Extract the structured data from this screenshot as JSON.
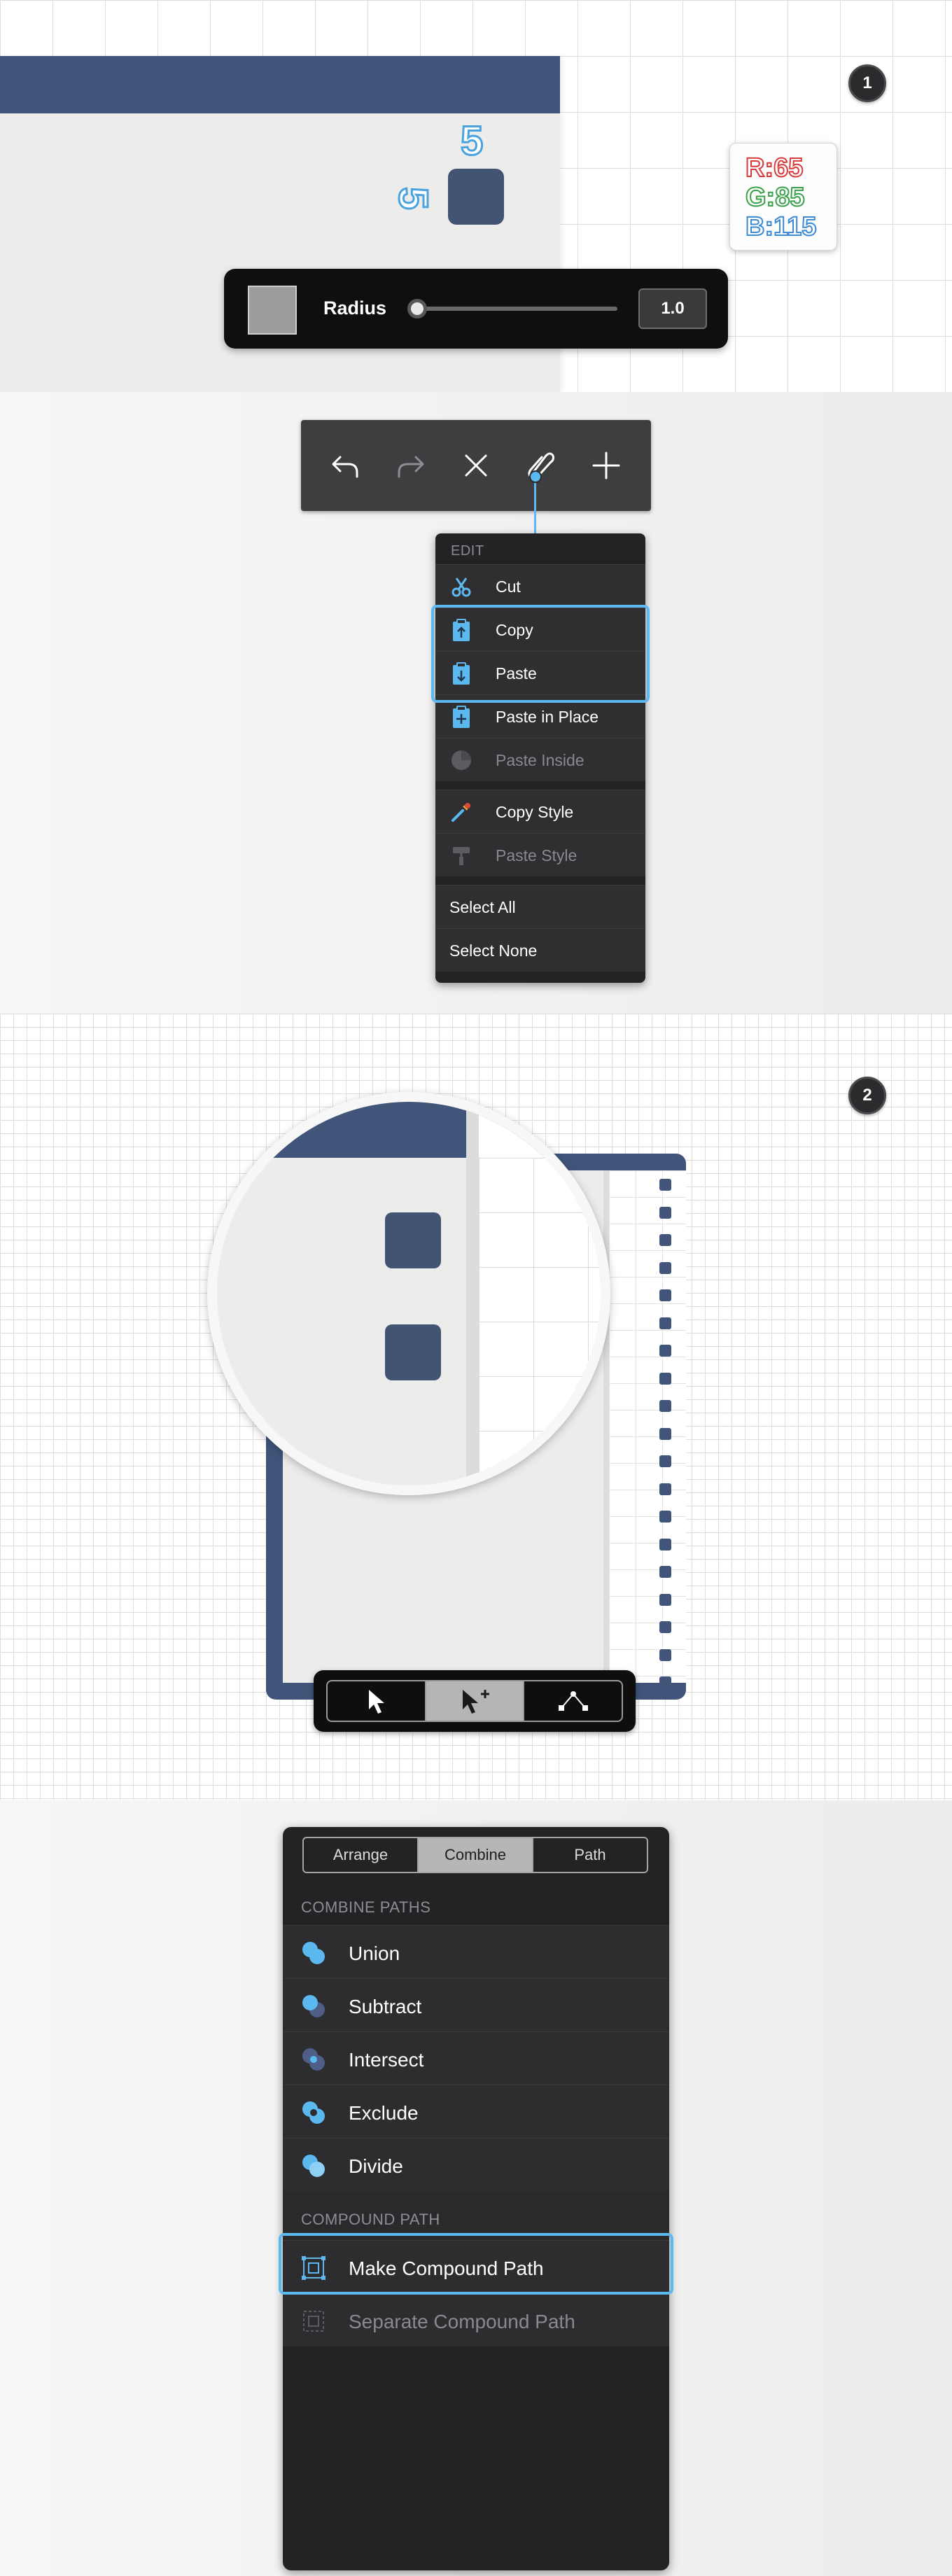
{
  "step1": {
    "badge": "1",
    "dimension_top": "5",
    "dimension_left": "5",
    "rgb": {
      "r": "R:65",
      "g": "G:85",
      "b": "B:115"
    },
    "radius_panel": {
      "label": "Radius",
      "value": "1.0"
    },
    "colors": {
      "fill": "#415573",
      "header": "#41557a"
    }
  },
  "step1_toolbar": {
    "buttons": [
      "undo-icon",
      "redo-icon",
      "close-icon",
      "paperclip-icon",
      "plus-icon"
    ]
  },
  "edit_menu": {
    "header": "EDIT",
    "items": [
      {
        "label": "Cut",
        "icon": "scissors-icon",
        "enabled": true
      },
      {
        "label": "Copy",
        "icon": "copy-clipboard-icon",
        "enabled": true
      },
      {
        "label": "Paste",
        "icon": "paste-clipboard-icon",
        "enabled": true
      },
      {
        "label": "Paste in Place",
        "icon": "paste-in-place-icon",
        "enabled": true
      },
      {
        "label": "Paste Inside",
        "icon": "paste-inside-icon",
        "enabled": false
      },
      {
        "label": "Copy Style",
        "icon": "eyedropper-icon",
        "enabled": true
      },
      {
        "label": "Paste Style",
        "icon": "paint-roller-icon",
        "enabled": false
      },
      {
        "label": "Select All",
        "enabled": true
      },
      {
        "label": "Select None",
        "enabled": true
      }
    ]
  },
  "step2": {
    "badge": "2",
    "selection_tools": [
      "select-arrow-icon",
      "add-select-arrow-icon",
      "node-path-icon"
    ]
  },
  "combine_panel": {
    "tabs": [
      "Arrange",
      "Combine",
      "Path"
    ],
    "active_tab": "Combine",
    "combine_paths_label": "COMBINE PATHS",
    "combine_items": [
      "Union",
      "Subtract",
      "Intersect",
      "Exclude",
      "Divide"
    ],
    "compound_path_label": "COMPOUND PATH",
    "compound_items": [
      {
        "label": "Make Compound Path",
        "enabled": true
      },
      {
        "label": "Separate Compound Path",
        "enabled": false
      }
    ]
  }
}
